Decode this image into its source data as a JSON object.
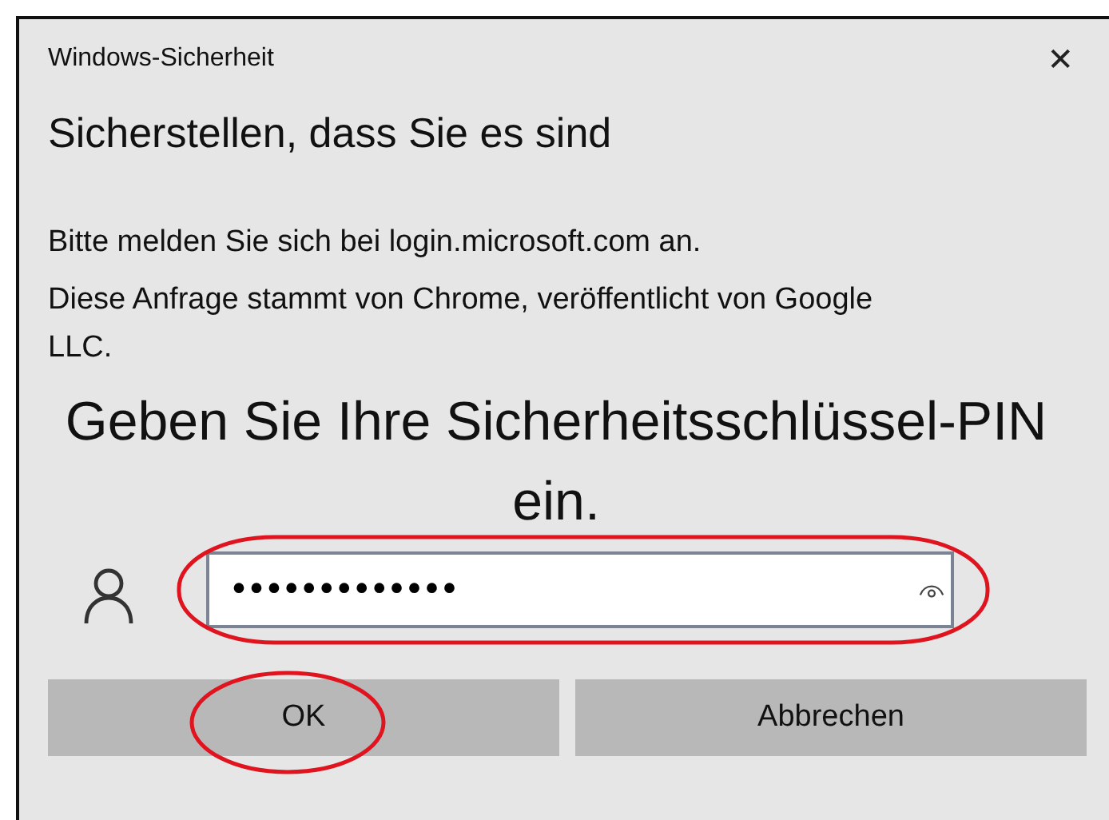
{
  "window": {
    "title": "Windows-Sicherheit",
    "close": "✕"
  },
  "heading": "Sicherstellen, dass Sie es sind",
  "messages": [
    "Bitte melden Sie sich bei login.microsoft.com an.",
    "Diese Anfrage stammt von Chrome, veröffentlicht von Google LLC."
  ],
  "prompt": "Geben Sie Ihre Sicherheitsschlüssel-PIN ein.",
  "pin_field": {
    "value": "•••••••••••••",
    "highlighted": true
  },
  "buttons": [
    {
      "label": "OK",
      "highlighted": true
    },
    {
      "label": "Abbrechen",
      "highlighted": false
    }
  ]
}
